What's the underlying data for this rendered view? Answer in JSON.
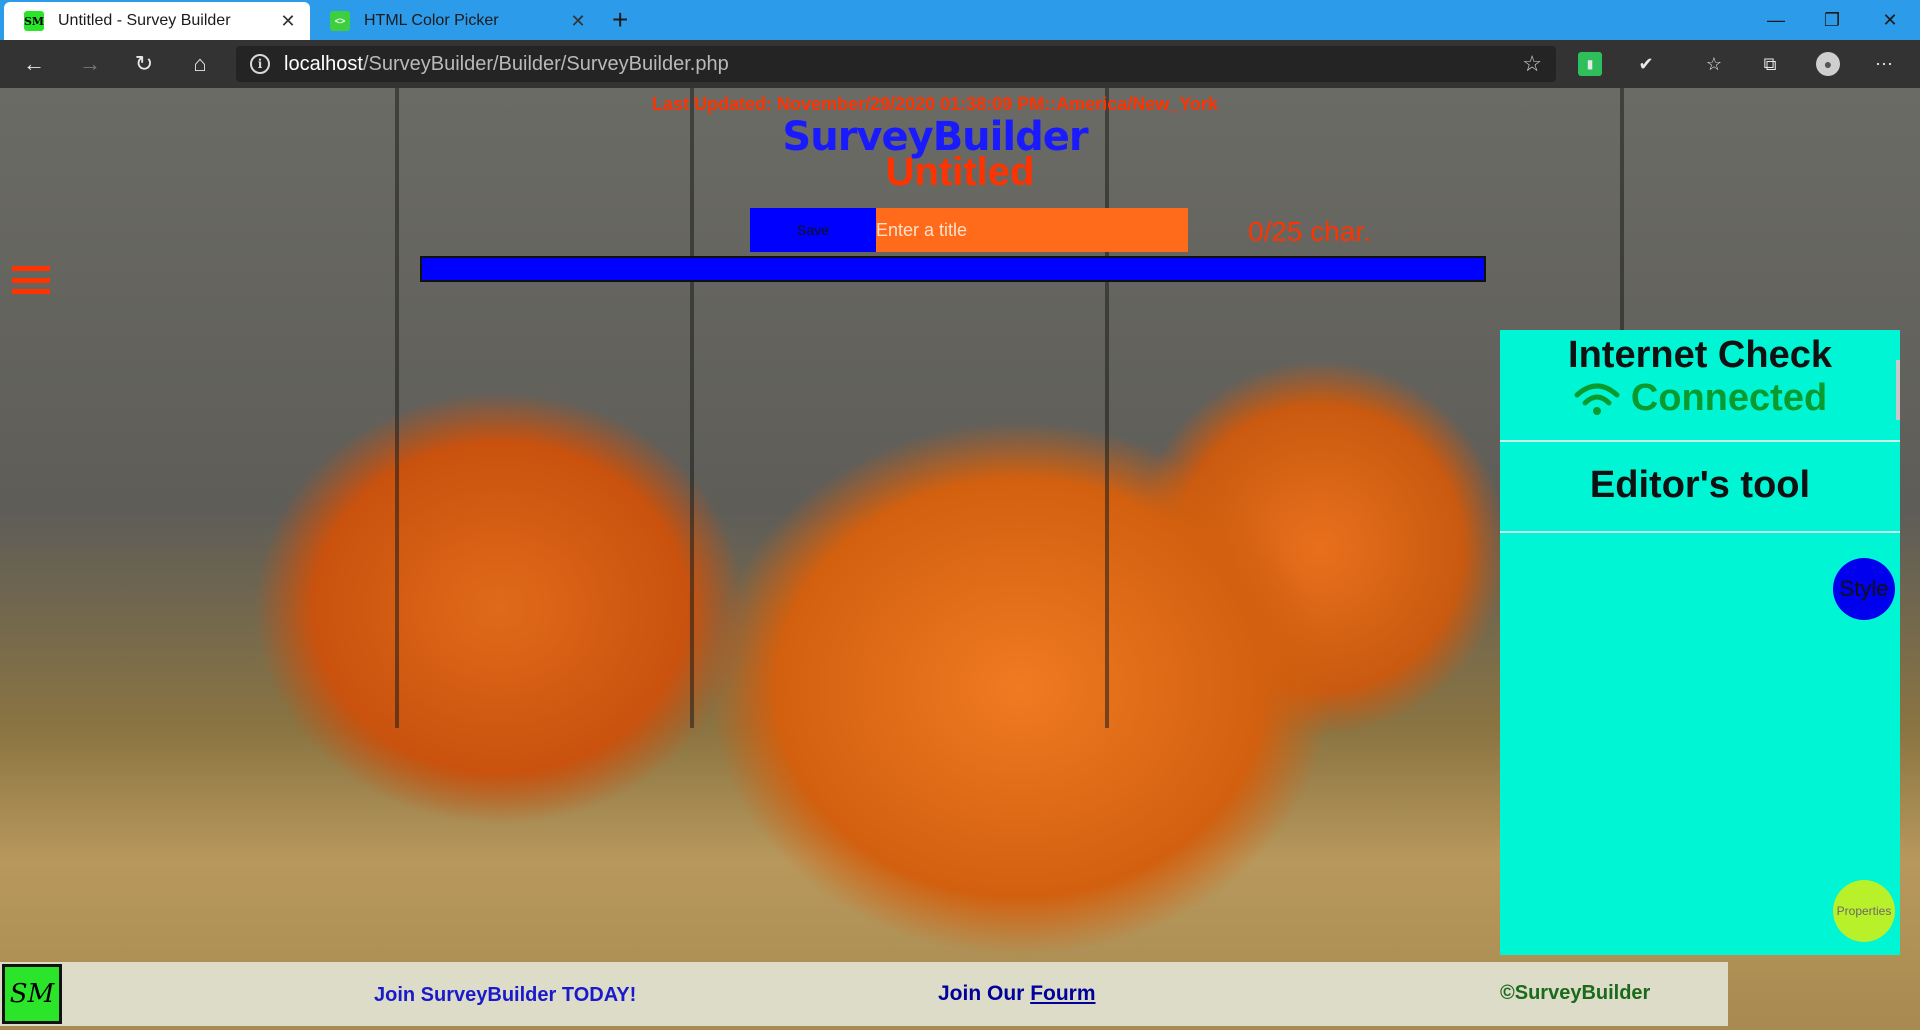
{
  "browser": {
    "tabs": [
      {
        "title": "Untitled - Survey Builder",
        "favicon_text": "SM"
      },
      {
        "title": "HTML Color Picker",
        "favicon_text": "<>"
      }
    ],
    "url_host": "localhost",
    "url_path": "/SurveyBuilder/Builder/SurveyBuilder.php",
    "icons": {
      "back": "back-arrow-icon",
      "forward": "forward-arrow-icon",
      "refresh": "refresh-icon",
      "home": "home-icon",
      "info": "info-icon",
      "favorite": "star-icon",
      "collections": "collections-icon",
      "favorites_list": "favorites-list-icon",
      "profile": "profile-icon",
      "menu": "more-icon"
    }
  },
  "page": {
    "last_updated": "Last Updated: November/29/2020 01:38:09 PM::America/New_York",
    "brand": "SurveyBuilder",
    "doc_title": "Untitled",
    "save_label": "Save",
    "title_placeholder": "Enter a title",
    "char_count": "0/25 char.",
    "colors": {
      "accent_orange": "#ff3300",
      "brand_blue": "#1a1aff",
      "panel": "#00f5d4",
      "connected": "#0a9a2e"
    }
  },
  "sidepanel": {
    "internet_title": "Internet Check",
    "internet_status": "Connected",
    "editor_title": "Editor's tool",
    "style_label": "Style",
    "properties_label": "Properties"
  },
  "footer": {
    "logo_text": "SM",
    "join_text": "Join SurveyBuilder TODAY!",
    "forum_prefix": "Join Our ",
    "forum_link": "Fourm",
    "copyright": "©SurveyBuilder"
  }
}
